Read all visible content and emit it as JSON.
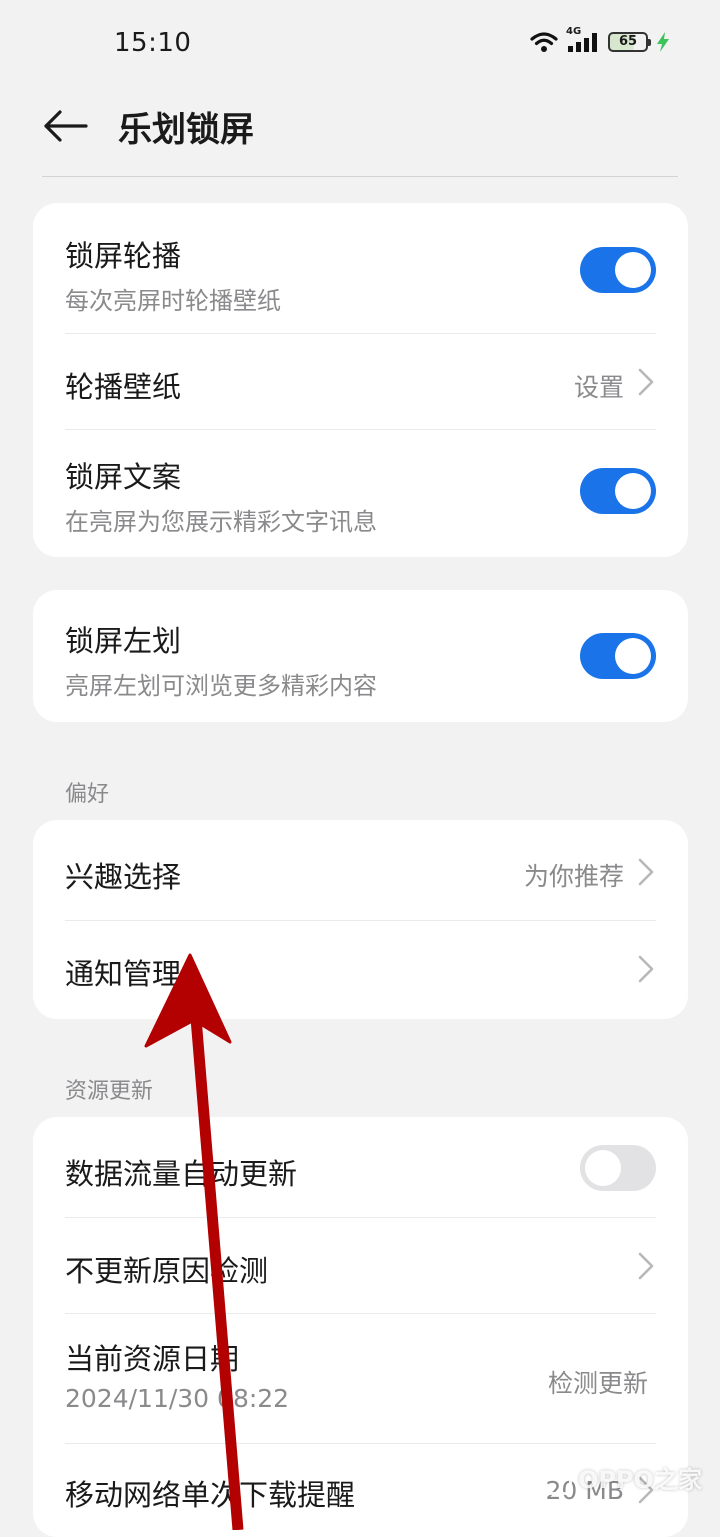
{
  "status_bar": {
    "time": "15:10",
    "network": "4G",
    "battery": "65"
  },
  "header": {
    "title": "乐划锁屏"
  },
  "card1": {
    "rows": [
      {
        "title": "锁屏轮播",
        "subtitle": "每次亮屏时轮播壁纸",
        "toggle": true
      },
      {
        "title": "轮播壁纸",
        "value": "设置"
      },
      {
        "title": "锁屏文案",
        "subtitle": "在亮屏为您展示精彩文字讯息",
        "toggle": true
      }
    ]
  },
  "card2": {
    "rows": [
      {
        "title": "锁屏左划",
        "subtitle": "亮屏左划可浏览更多精彩内容",
        "toggle": true
      }
    ]
  },
  "preferences": {
    "label": "偏好",
    "rows": [
      {
        "title": "兴趣选择",
        "value": "为你推荐"
      },
      {
        "title": "通知管理"
      }
    ]
  },
  "resources": {
    "label": "资源更新",
    "rows": [
      {
        "title": "数据流量自动更新",
        "toggle": false
      },
      {
        "title": "不更新原因检测"
      },
      {
        "title": "当前资源日期",
        "subtitle": "2024/11/30 08:22",
        "value": "检测更新"
      },
      {
        "title": "移动网络单次下载提醒",
        "value": "20 MB"
      }
    ]
  },
  "watermark": {
    "text": "OPPO之家"
  },
  "colors": {
    "accent": "#1a73e8",
    "annotation": "#b30000"
  }
}
